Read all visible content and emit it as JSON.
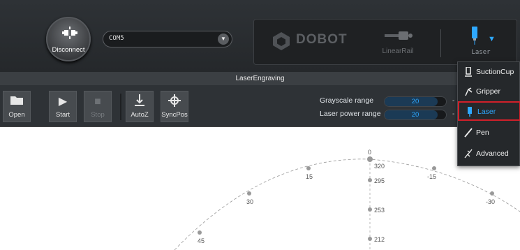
{
  "header": {
    "disconnect_label": "Disconnect",
    "port_value": "COM5",
    "brand": "DOBOT",
    "linear_rail_label": "LinearRail",
    "tool_label": "Laser"
  },
  "mode_title": "LaserEngraving",
  "toolbar": {
    "open": "Open",
    "start": "Start",
    "stop": "Stop",
    "autoz": "AutoZ",
    "syncpos": "SyncPos"
  },
  "params": {
    "grayscale_label": "Grayscale  range",
    "grayscale_value": "20",
    "laser_power_label": "Laser power range",
    "laser_power_value": "20",
    "dash": "-"
  },
  "end_effector_menu": {
    "items": [
      {
        "label": "SuctionCup",
        "icon": "suction-cup-icon",
        "selected": false
      },
      {
        "label": "Gripper",
        "icon": "gripper-icon",
        "selected": false
      },
      {
        "label": "Laser",
        "icon": "laser-icon",
        "selected": true
      },
      {
        "label": "Pen",
        "icon": "pen-icon",
        "selected": false
      },
      {
        "label": "Advanced",
        "icon": "advanced-icon",
        "selected": false
      }
    ]
  },
  "workspace": {
    "angle_labels": [
      "0",
      "15",
      "-15",
      "30",
      "-30",
      "45"
    ],
    "radius_labels": [
      "320",
      "295",
      "253",
      "212"
    ]
  },
  "colors": {
    "accent": "#2ea8ff",
    "selected_border": "#d0202a",
    "panel": "#2e3236"
  }
}
